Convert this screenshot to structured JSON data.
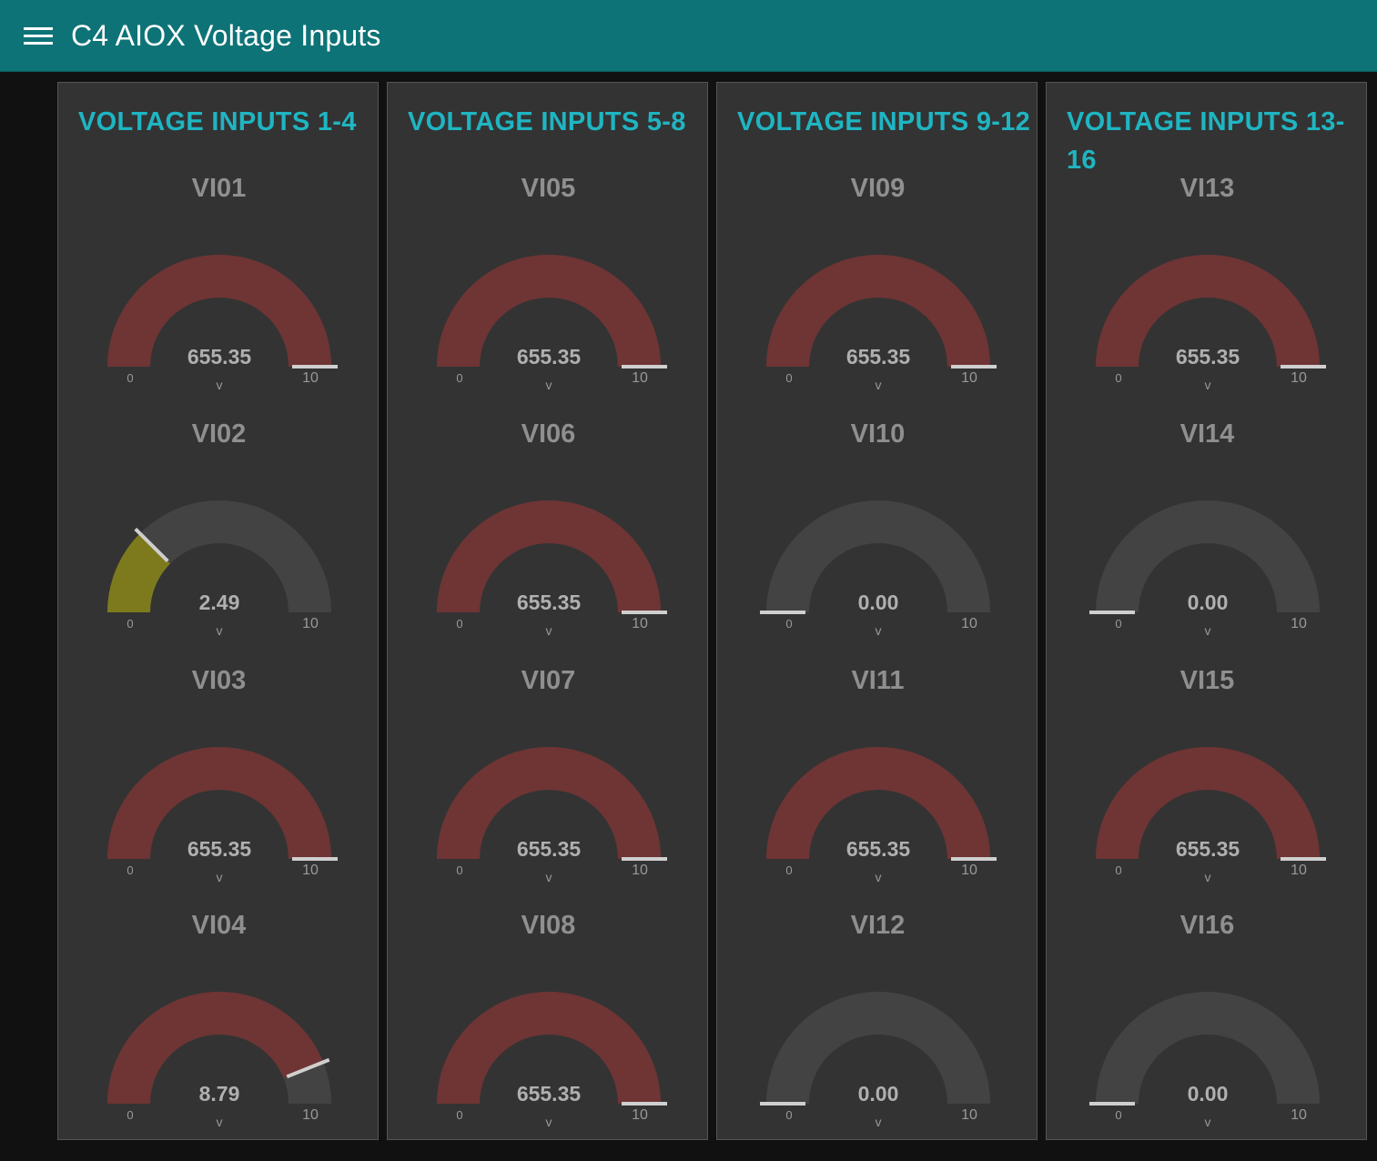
{
  "header": {
    "title": "C4 AIOX Voltage Inputs",
    "menu_icon": "hamburger-menu-icon"
  },
  "colors": {
    "toolbar": "#0d7377",
    "group_title": "#1fb5c2",
    "gauge_track": "#434343",
    "gauge_over": "#6f3434",
    "gauge_low": "#7d7a1e",
    "gauge_high": "#6f3434",
    "needle": "#cfcfcf"
  },
  "groups": [
    {
      "title": "VOLTAGE INPUTS 1-4",
      "gauges": [
        {
          "label": "VI01",
          "value": 655.35,
          "display": "655.35",
          "unit": "v",
          "min": "0",
          "max": "10"
        },
        {
          "label": "VI02",
          "value": 2.49,
          "display": "2.49",
          "unit": "v",
          "min": "0",
          "max": "10"
        },
        {
          "label": "VI03",
          "value": 655.35,
          "display": "655.35",
          "unit": "v",
          "min": "0",
          "max": "10"
        },
        {
          "label": "VI04",
          "value": 8.79,
          "display": "8.79",
          "unit": "v",
          "min": "0",
          "max": "10"
        }
      ]
    },
    {
      "title": "VOLTAGE INPUTS 5-8",
      "gauges": [
        {
          "label": "VI05",
          "value": 655.35,
          "display": "655.35",
          "unit": "v",
          "min": "0",
          "max": "10"
        },
        {
          "label": "VI06",
          "value": 655.35,
          "display": "655.35",
          "unit": "v",
          "min": "0",
          "max": "10"
        },
        {
          "label": "VI07",
          "value": 655.35,
          "display": "655.35",
          "unit": "v",
          "min": "0",
          "max": "10"
        },
        {
          "label": "VI08",
          "value": 655.35,
          "display": "655.35",
          "unit": "v",
          "min": "0",
          "max": "10"
        }
      ]
    },
    {
      "title": "VOLTAGE INPUTS 9-12",
      "gauges": [
        {
          "label": "VI09",
          "value": 655.35,
          "display": "655.35",
          "unit": "v",
          "min": "0",
          "max": "10"
        },
        {
          "label": "VI10",
          "value": 0.0,
          "display": "0.00",
          "unit": "v",
          "min": "0",
          "max": "10"
        },
        {
          "label": "VI11",
          "value": 655.35,
          "display": "655.35",
          "unit": "v",
          "min": "0",
          "max": "10"
        },
        {
          "label": "VI12",
          "value": 0.0,
          "display": "0.00",
          "unit": "v",
          "min": "0",
          "max": "10"
        }
      ]
    },
    {
      "title": "VOLTAGE INPUTS 13-16",
      "gauges": [
        {
          "label": "VI13",
          "value": 655.35,
          "display": "655.35",
          "unit": "v",
          "min": "0",
          "max": "10"
        },
        {
          "label": "VI14",
          "value": 0.0,
          "display": "0.00",
          "unit": "v",
          "min": "0",
          "max": "10"
        },
        {
          "label": "VI15",
          "value": 655.35,
          "display": "655.35",
          "unit": "v",
          "min": "0",
          "max": "10"
        },
        {
          "label": "VI16",
          "value": 0.0,
          "display": "0.00",
          "unit": "v",
          "min": "0",
          "max": "10"
        }
      ]
    }
  ]
}
